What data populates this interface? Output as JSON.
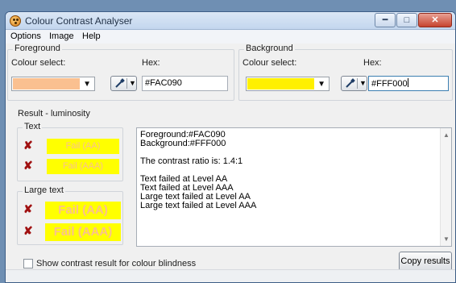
{
  "window": {
    "title": "Colour Contrast Analyser",
    "minimize_icon": "minimize-icon",
    "maximize_icon": "maximize-icon",
    "close_icon": "close-icon"
  },
  "menu": [
    "Options",
    "Image",
    "Help"
  ],
  "foreground": {
    "group_label": "Foreground",
    "colour_select_label": "Colour select:",
    "hex_label": "Hex:",
    "hex_value": "#FAC090",
    "swatch_color": "#FAC090"
  },
  "background": {
    "group_label": "Background",
    "colour_select_label": "Colour select:",
    "hex_label": "Hex:",
    "hex_value": "#FFF000",
    "swatch_color": "#FFF000"
  },
  "result": {
    "group_label": "Result - luminosity",
    "text_group_label": "Text",
    "large_text_group_label": "Large text",
    "text_aa": "Fail (AA)",
    "text_aaa": "Fail (AAA)",
    "large_aa": "Fail (AA)",
    "large_aaa": "Fail (AAA)",
    "fail_icon": "fail-x-icon",
    "details": [
      "Foreground:#FAC090",
      "Background:#FFF000",
      "",
      "The contrast ratio is: 1.4:1",
      "",
      "Text failed at Level AA",
      "Text failed at Level AAA",
      "Large text failed at Level AA",
      "Large text failed at Level AAA"
    ]
  },
  "colour_blindness_checkbox": {
    "label": "Show contrast result for colour blindness",
    "checked": false
  },
  "copy_button": "Copy results",
  "colors": {
    "fail_mark": "#A01010",
    "result_bg": "#FFFF00",
    "result_fg": "#FAC090"
  }
}
